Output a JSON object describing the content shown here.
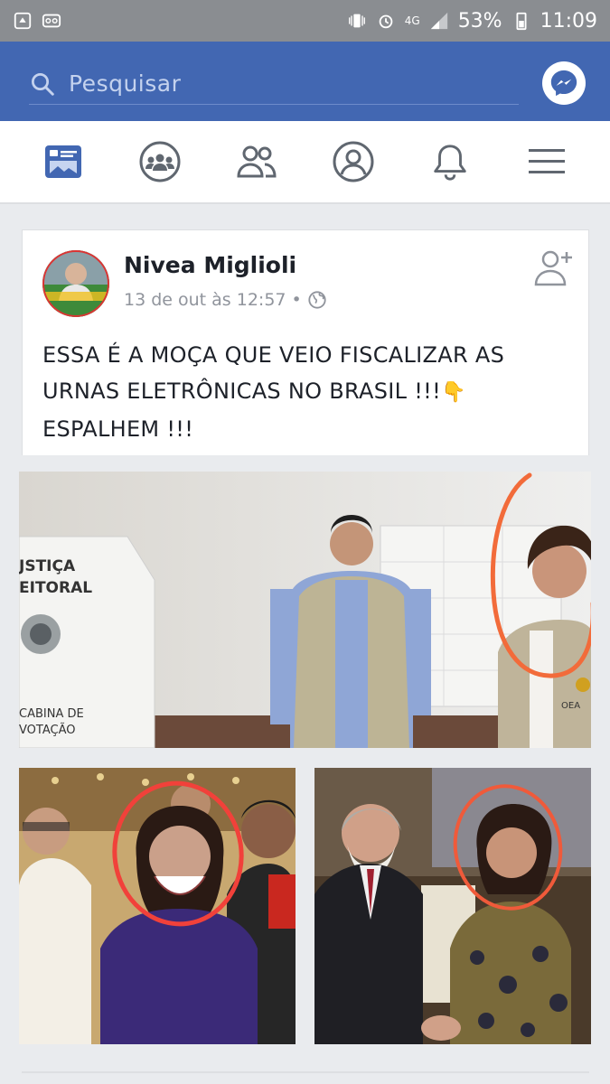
{
  "status_bar": {
    "battery_percent": "53%",
    "time": "11:09",
    "network": "4G",
    "icons": [
      "recycle-icon",
      "voicemail-icon",
      "vibrate-icon",
      "alarm-icon",
      "signal-icon",
      "battery-icon"
    ]
  },
  "search": {
    "placeholder": "Pesquisar",
    "icon": "search-icon",
    "messenger_icon": "messenger-icon"
  },
  "nav": {
    "tabs": [
      {
        "name": "news-feed",
        "icon": "news-feed-icon",
        "active": true
      },
      {
        "name": "groups",
        "icon": "groups-icon",
        "active": false
      },
      {
        "name": "friends",
        "icon": "friends-icon",
        "active": false
      },
      {
        "name": "profile",
        "icon": "profile-icon",
        "active": false
      },
      {
        "name": "notifications",
        "icon": "bell-icon",
        "active": false
      },
      {
        "name": "menu",
        "icon": "hamburger-icon",
        "active": false
      }
    ]
  },
  "post": {
    "author": "Nivea Miglioli",
    "timestamp": "13 de out às 12:57",
    "separator": "•",
    "privacy_icon": "globe-icon",
    "text_line1": "ESSA É A MOÇA  QUE VEIO FISCALIZAR AS",
    "text_line2": "URNAS ELETRÔNICAS NO BRASIL !!!",
    "text_line3": "ESPALHEM !!!",
    "emoji": "👇"
  },
  "photos": {
    "main_sign_line1": "JSTIÇA",
    "main_sign_line2": "EITORAL",
    "main_sign_line3": "CABINA DE",
    "main_sign_line4": "VOTAÇÃO",
    "vest_label": "OEA"
  },
  "colors": {
    "facebook_blue": "#4267b2",
    "status_bar": "#8a8d91",
    "highlight_circle": "#f26b3a"
  }
}
